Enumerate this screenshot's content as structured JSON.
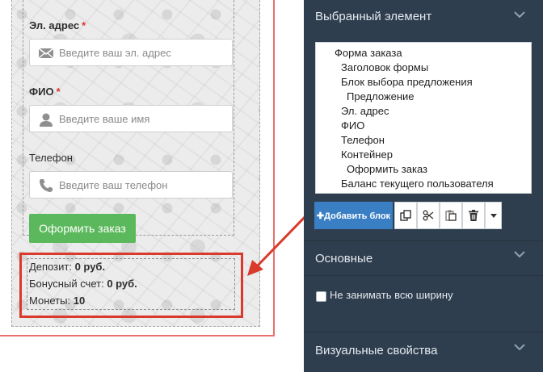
{
  "form": {
    "email": {
      "label": "Эл. адрес",
      "required_mark": "*",
      "placeholder": "Введите ваш эл. адрес"
    },
    "name": {
      "label": "ФИО",
      "required_mark": "*",
      "placeholder": "Введите ваше имя"
    },
    "phone": {
      "label": "Телефон",
      "placeholder": "Введите ваш телефон"
    },
    "submit_label": "Оформить заказ",
    "submit_color": "#5cb85c"
  },
  "balance": {
    "deposit_label": "Депозит:",
    "deposit_value": "0 руб.",
    "bonus_label": "Бонусный счет:",
    "bonus_value": "0 руб.",
    "coins_label": "Монеты:",
    "coins_value": "10"
  },
  "panel": {
    "selected_section_title": "Выбранный элемент",
    "tree": [
      "Форма заказа",
      "Заголовок формы",
      "Блок выбора предложения",
      "Предложение",
      "Эл. адрес",
      "ФИО",
      "Телефон",
      "Контейнер",
      "Оформить заказ",
      "Баланс текущего пользователя"
    ],
    "toolbar": {
      "add_block_label": "✚Добавить блок"
    },
    "basic_section_title": "Основные",
    "full_width_label": "Не занимать всю ширину",
    "visual_section_title": "Визуальные свойства"
  },
  "colors": {
    "panel_bg": "#2f3e4e",
    "accent_blue": "#3a7fc4",
    "highlight_red": "#d93a2b",
    "required_red": "#e0342e"
  },
  "icons": [
    "envelope-icon",
    "user-icon",
    "phone-icon",
    "copy-icon",
    "scissors-icon",
    "paste-icon",
    "trash-icon",
    "caret-down-icon",
    "chevron-down-icon"
  ]
}
